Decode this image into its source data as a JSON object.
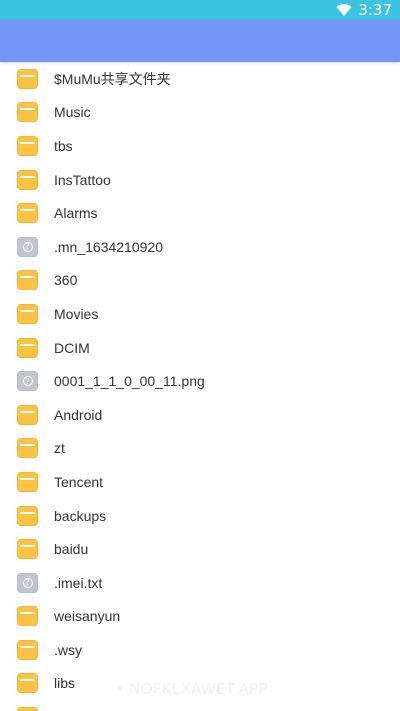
{
  "status_bar": {
    "time": "3:37",
    "background": "#3bc3e3",
    "icons": [
      "wifi-icon"
    ]
  },
  "app_bar": {
    "background": "#7395f5"
  },
  "files": [
    {
      "name": "$MuMu共享文件夹",
      "type": "folder"
    },
    {
      "name": "Music",
      "type": "folder"
    },
    {
      "name": "tbs",
      "type": "folder"
    },
    {
      "name": "InsTattoo",
      "type": "folder"
    },
    {
      "name": "Alarms",
      "type": "folder"
    },
    {
      "name": ".mn_1634210920",
      "type": "unknown"
    },
    {
      "name": "360",
      "type": "folder"
    },
    {
      "name": "Movies",
      "type": "folder"
    },
    {
      "name": "DCIM",
      "type": "folder"
    },
    {
      "name": "0001_1_1_0_00_11.png",
      "type": "unknown"
    },
    {
      "name": "Android",
      "type": "folder"
    },
    {
      "name": "zt",
      "type": "folder"
    },
    {
      "name": "Tencent",
      "type": "folder"
    },
    {
      "name": "backups",
      "type": "folder"
    },
    {
      "name": "baidu",
      "type": "folder"
    },
    {
      "name": ".imei.txt",
      "type": "unknown"
    },
    {
      "name": "weisanyun",
      "type": "folder"
    },
    {
      "name": ".wsy",
      "type": "folder"
    },
    {
      "name": "libs",
      "type": "folder"
    },
    {
      "name": "",
      "type": "folder"
    }
  ],
  "icon_colors": {
    "folder": "#fbc341",
    "unknown": "#c1c5ce"
  },
  "watermark": "• NOFKLXAWET.APP"
}
